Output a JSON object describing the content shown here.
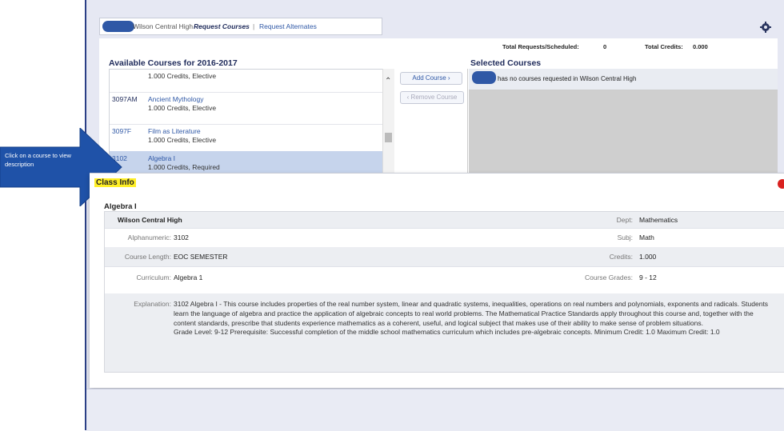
{
  "tabs": {
    "school": "Wilson Central High",
    "request_courses": "Request Courses",
    "separator": "|",
    "request_alternates": "Request Alternates"
  },
  "totals": {
    "requests_label": "Total Requests/Scheduled:",
    "requests_value": "0",
    "credits_label": "Total Credits:",
    "credits_value": "0.000"
  },
  "available": {
    "title": "Available Courses for 2016-2017",
    "courses": [
      {
        "code": "",
        "name": "",
        "meta": "1.000 Credits,  Elective"
      },
      {
        "code": "3097AM",
        "name": "Ancient Mythology",
        "meta": "1.000 Credits,  Elective"
      },
      {
        "code": "3097F",
        "name": "Film as Literature",
        "meta": "1.000 Credits,  Elective"
      },
      {
        "code": "3102",
        "name": "Algebra I",
        "meta": "1.000 Credits,  Required"
      }
    ]
  },
  "buttons": {
    "add": "Add Course ›",
    "remove": "‹ Remove Course"
  },
  "selected": {
    "title": "Selected Courses",
    "empty_message": "has no courses requested in Wilson Central High"
  },
  "callout": {
    "text": "Click on a course to view description"
  },
  "class_info": {
    "title": "Class Info",
    "course_title": "Algebra I",
    "school": "Wilson Central High",
    "dept_label": "Dept:",
    "dept": "Mathematics",
    "alphanum_label": "Alphanumeric:",
    "alphanum": "3102",
    "subj_label": "Subj:",
    "subj": "Math",
    "length_label": "Course Length:",
    "length": "EOC SEMESTER",
    "credits_label": "Credits:",
    "credits": "1.000",
    "curriculum_label": "Curriculum:",
    "curriculum": "Algebra 1",
    "grades_label": "Course Grades:",
    "grades": "9 - 12",
    "explanation_label": "Explanation:",
    "explanation": "3102 Algebra I - This course includes properties of the real number system, linear and quadratic systems, inequalities, operations on real numbers and polynomials, exponents and radicals. Students learn the language of algebra and practice the application of algebraic concepts to real world problems. The Mathematical Practice Standards apply throughout this course and, together with the content standards, prescribe that students experience mathematics as a coherent, useful, and logical subject that makes use of their ability to make sense of problem situations.",
    "explanation_2": "Grade Level: 9-12 Prerequisite: Successful completion of the middle school mathematics curriculum which includes pre-algebraic concepts. Minimum Credit: 1.0 Maximum Credit: 1.0"
  },
  "colors": {
    "accent": "#2f58a6",
    "highlight": "#ffef27",
    "close": "#d9211f"
  }
}
